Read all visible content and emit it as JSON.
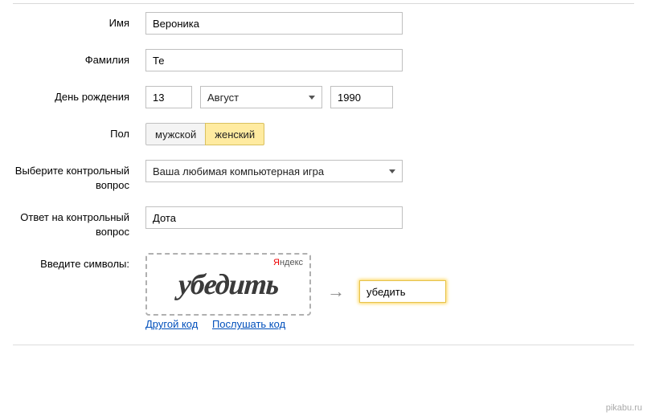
{
  "labels": {
    "name": "Имя",
    "surname": "Фамилия",
    "birthday": "День рождения",
    "gender": "Пол",
    "question": "Выберите контрольный вопрос",
    "answer": "Ответ на контрольный вопрос",
    "captcha": "Введите символы:"
  },
  "fields": {
    "name": "Вероника",
    "surname": "Те",
    "day": "13",
    "month": "Август",
    "year": "1990",
    "gender_male": "мужской",
    "gender_female": "женский",
    "gender_selected": "female",
    "question": "Ваша любимая компьютерная игра",
    "answer": "Дота",
    "captcha_value": "убедить"
  },
  "captcha": {
    "word_hint": "убедить",
    "brand_y": "Я",
    "brand_rest": "ндекс",
    "link_other": "Другой код",
    "link_listen": "Послушать код"
  },
  "watermark": "pikabu.ru"
}
